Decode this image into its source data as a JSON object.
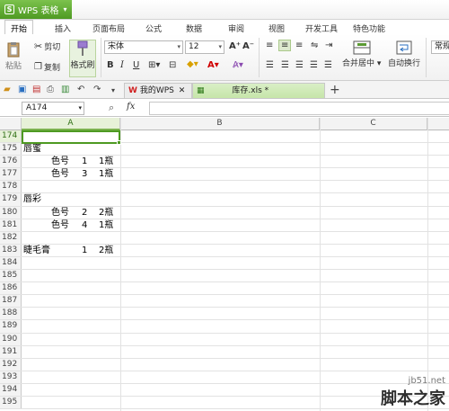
{
  "app": {
    "title": "WPS 表格"
  },
  "menu_tabs": [
    "开始",
    "插入",
    "页面布局",
    "公式",
    "数据",
    "审阅",
    "视图",
    "开发工具",
    "特色功能"
  ],
  "ribbon": {
    "paste": "粘贴",
    "cut": "剪切",
    "copy": "复制",
    "format_painter": "格式刷",
    "font_name": "宋体",
    "font_size": "12",
    "merge_center": "合并居中",
    "wrap_text": "自动换行",
    "number_format": "常规"
  },
  "doc_tabs": {
    "home": "我的WPS",
    "file": "库存.xls *"
  },
  "formula_bar": {
    "name_box": "A174",
    "fx": "fx",
    "formula": ""
  },
  "columns": [
    "A",
    "B",
    "C"
  ],
  "rows": [
    {
      "num": "174",
      "a": "",
      "b": "",
      "c": "",
      "d": ""
    },
    {
      "num": "175",
      "a": "唇蜜",
      "b": "",
      "c": "",
      "d": ""
    },
    {
      "num": "176",
      "a": "",
      "b": "色号",
      "c": "1",
      "d": "1瓶"
    },
    {
      "num": "177",
      "a": "",
      "b": "色号",
      "c": "3",
      "d": "1瓶"
    },
    {
      "num": "178",
      "a": "",
      "b": "",
      "c": "",
      "d": ""
    },
    {
      "num": "179",
      "a": "唇彩",
      "b": "",
      "c": "",
      "d": ""
    },
    {
      "num": "180",
      "a": "",
      "b": "色号",
      "c": "2",
      "d": "2瓶"
    },
    {
      "num": "181",
      "a": "",
      "b": "色号",
      "c": "4",
      "d": "1瓶"
    },
    {
      "num": "182",
      "a": "",
      "b": "",
      "c": "",
      "d": ""
    },
    {
      "num": "183",
      "a": "睫毛膏",
      "b": "",
      "c": "1",
      "d": "2瓶"
    },
    {
      "num": "184",
      "a": "",
      "b": "",
      "c": "",
      "d": ""
    },
    {
      "num": "185",
      "a": "",
      "b": "",
      "c": "",
      "d": ""
    },
    {
      "num": "186",
      "a": "",
      "b": "",
      "c": "",
      "d": ""
    },
    {
      "num": "187",
      "a": "",
      "b": "",
      "c": "",
      "d": ""
    },
    {
      "num": "188",
      "a": "",
      "b": "",
      "c": "",
      "d": ""
    },
    {
      "num": "189",
      "a": "",
      "b": "",
      "c": "",
      "d": ""
    },
    {
      "num": "190",
      "a": "",
      "b": "",
      "c": "",
      "d": ""
    },
    {
      "num": "191",
      "a": "",
      "b": "",
      "c": "",
      "d": ""
    },
    {
      "num": "192",
      "a": "",
      "b": "",
      "c": "",
      "d": ""
    },
    {
      "num": "193",
      "a": "",
      "b": "",
      "c": "",
      "d": ""
    },
    {
      "num": "194",
      "a": "",
      "b": "",
      "c": "",
      "d": ""
    },
    {
      "num": "195",
      "a": "",
      "b": "",
      "c": "",
      "d": ""
    }
  ],
  "watermark": {
    "site": "jb51.net",
    "brand": "脚本之家"
  },
  "colors": {
    "accent": "#4e9a22",
    "selection": "#e7f1d8"
  }
}
